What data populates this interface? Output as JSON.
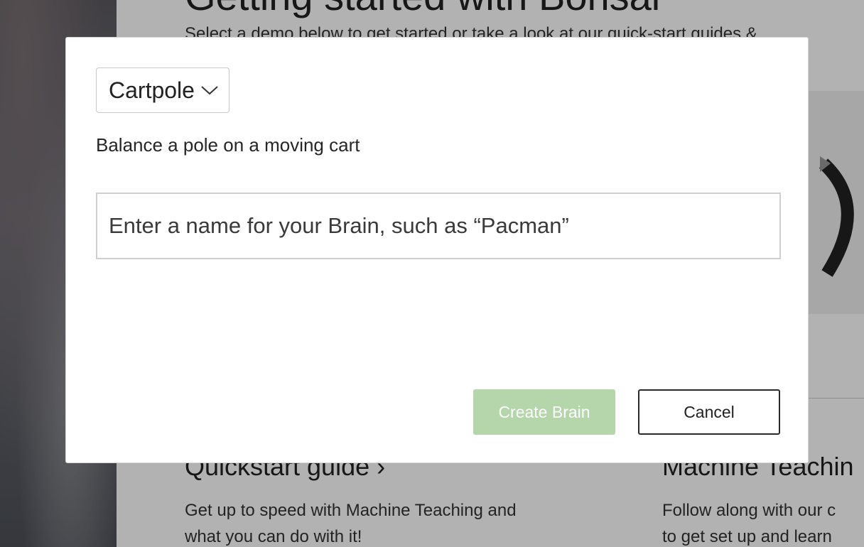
{
  "background": {
    "title": "Getting started with Bonsai",
    "subtitle": "Select a demo below to get started or take a look at our quick-start guides &",
    "columns": [
      {
        "title": "Quickstart guide ›",
        "text": "Get up to speed with Machine Teaching and\nwhat you can do with it!"
      },
      {
        "title": "Machine Teachin",
        "text": "Follow along with our c\nto get set up and learn"
      }
    ]
  },
  "modal": {
    "demo_select": {
      "selected": "Cartpole",
      "icon": "chevron-down-icon"
    },
    "demo_description": "Balance a pole on a moving cart",
    "brain_name_input": {
      "value": "",
      "placeholder": "Enter a name for your Brain, such as “Pacman”"
    },
    "create_label": "Create Brain",
    "cancel_label": "Cancel"
  },
  "colors": {
    "create_button_bg": "#b5d6aa",
    "create_button_text": "#ffffff",
    "overlay": "rgba(0,0,0,0.30)"
  }
}
